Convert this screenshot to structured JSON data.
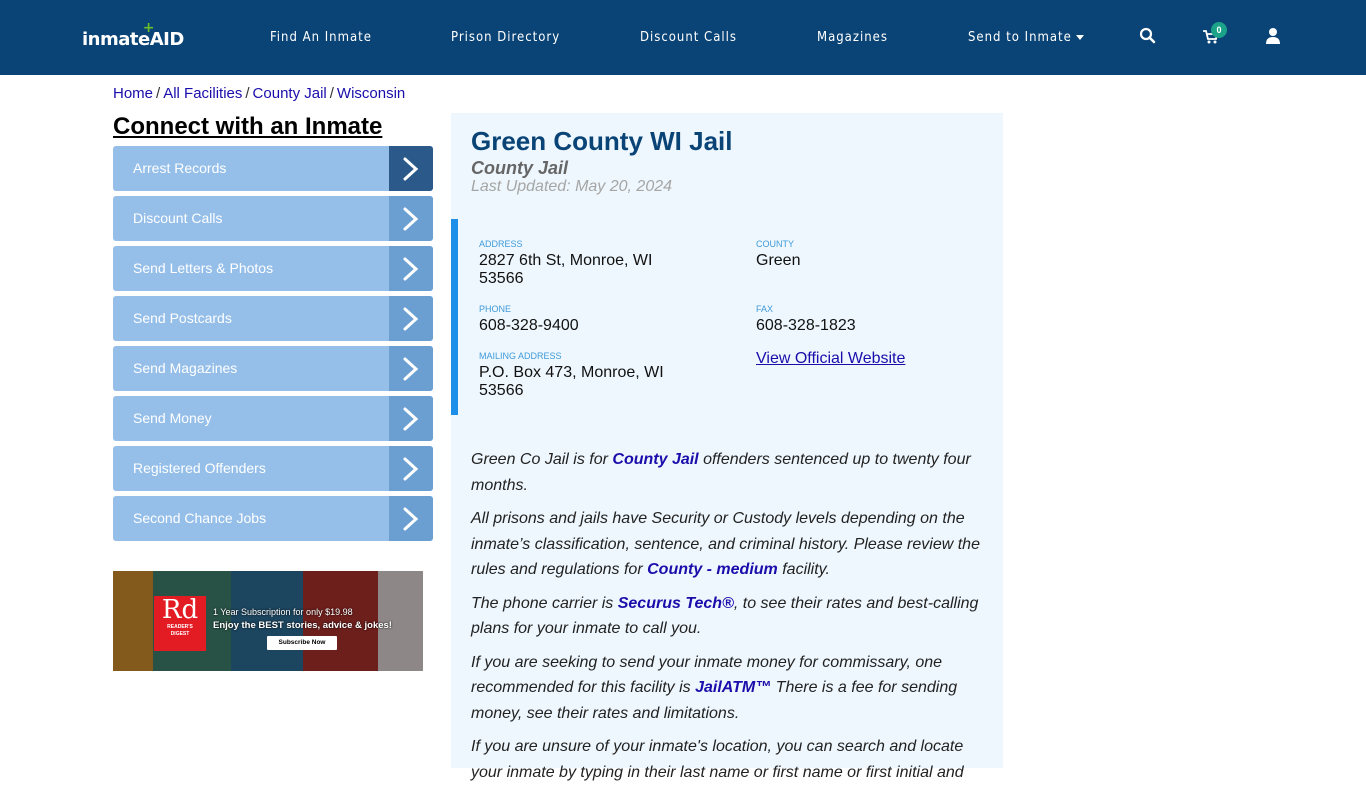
{
  "header": {
    "logo_text": "inmate",
    "logo_accent": "AID",
    "nav": [
      "Find An Inmate",
      "Prison Directory",
      "Discount Calls",
      "Magazines",
      "Send to Inmate"
    ],
    "cart_count": "0",
    "colors": {
      "bar": "#0a4375",
      "badge": "#1aa388"
    }
  },
  "breadcrumb": [
    "Home",
    "All Facilities",
    "County Jail",
    "Wisconsin"
  ],
  "sidebar": {
    "title": "Connect with an Inmate",
    "items": [
      {
        "label": "Arrest Records"
      },
      {
        "label": "Discount Calls"
      },
      {
        "label": "Send Letters & Photos"
      },
      {
        "label": "Send Postcards"
      },
      {
        "label": "Send Magazines"
      },
      {
        "label": "Send Money"
      },
      {
        "label": "Registered Offenders"
      },
      {
        "label": "Second Chance Jobs"
      }
    ]
  },
  "ad": {
    "brand_short": "Rd",
    "brand_line1": "READER'S",
    "brand_line2": "DIGEST",
    "line1": "1 Year Subscription for only $19.98",
    "line2": "Enjoy the BEST stories, advice & jokes!",
    "button": "Subscribe Now"
  },
  "facility": {
    "name": "Green County WI Jail",
    "type": "County Jail",
    "last_updated": "Last Updated: May 20, 2024",
    "address_label": "ADDRESS",
    "address": "2827 6th St, Monroe, WI 53566",
    "county_label": "COUNTY",
    "county": "Green",
    "phone_label": "PHONE",
    "phone": "608-328-9400",
    "fax_label": "FAX",
    "fax": "608-328-1823",
    "mailing_label": "MAILING ADDRESS",
    "mailing": "P.O. Box 473, Monroe, WI 53566",
    "website_link": "View Official Website"
  },
  "description": {
    "p1_a": "Green Co Jail is for ",
    "p1_link": "County Jail",
    "p1_b": " offenders sentenced up to twenty four months.",
    "p2_a": "All prisons and jails have Security or Custody levels depending on the inmate’s classification, sentence, and criminal history. Please review the rules and regulations for ",
    "p2_link": "County - medium",
    "p2_b": " facility.",
    "p3_a": "The phone carrier is ",
    "p3_link": "Securus Tech®",
    "p3_b": ", to see their rates and best-calling plans for your inmate to call you.",
    "p4_a": "If you are seeking to send your inmate money for commissary, one recommended for this facility is ",
    "p4_link": "JailATM™",
    "p4_b": " There is a fee for sending money, see their rates and limitations.",
    "p5": "If you are unsure of your inmate's location, you can search and locate your inmate by typing in their last name or first name or first initial and"
  }
}
